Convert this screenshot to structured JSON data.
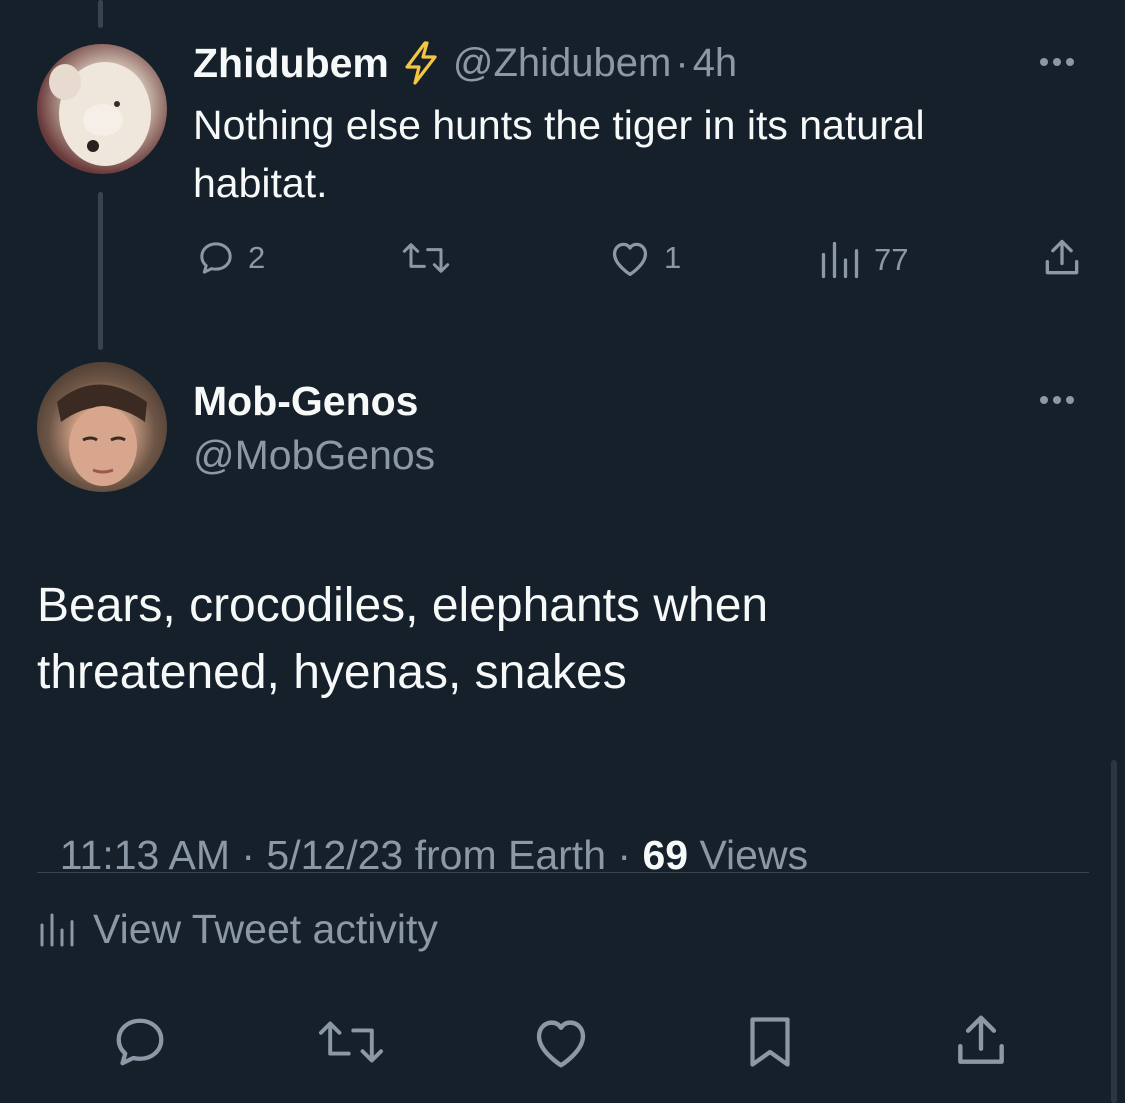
{
  "parent_tweet": {
    "display_name": "Zhidubem",
    "verified_icon": "lightning-bolt-icon",
    "handle": "@Zhidubem",
    "separator": "·",
    "time": "4h",
    "text_line1": "Nothing else hunts the tiger in its natural",
    "text_line2": "habitat.",
    "replies": "2",
    "retweets": "",
    "likes": "1",
    "views": "77"
  },
  "main_tweet": {
    "display_name": "Mob-Genos",
    "handle": "@MobGenos",
    "text_line1": "Bears, crocodiles, elephants when",
    "text_line2": "threatened, hyenas, snakes",
    "timestamp": "11:13 AM · 5/12/23 from Earth · ",
    "views_count": "69",
    "views_label": " Views",
    "activity_label": "View Tweet activity"
  },
  "colors": {
    "background": "#15202b",
    "text": "#f7f9f9",
    "muted": "#8b98a5",
    "divider": "#38444d",
    "lightning": "#f4c542"
  }
}
